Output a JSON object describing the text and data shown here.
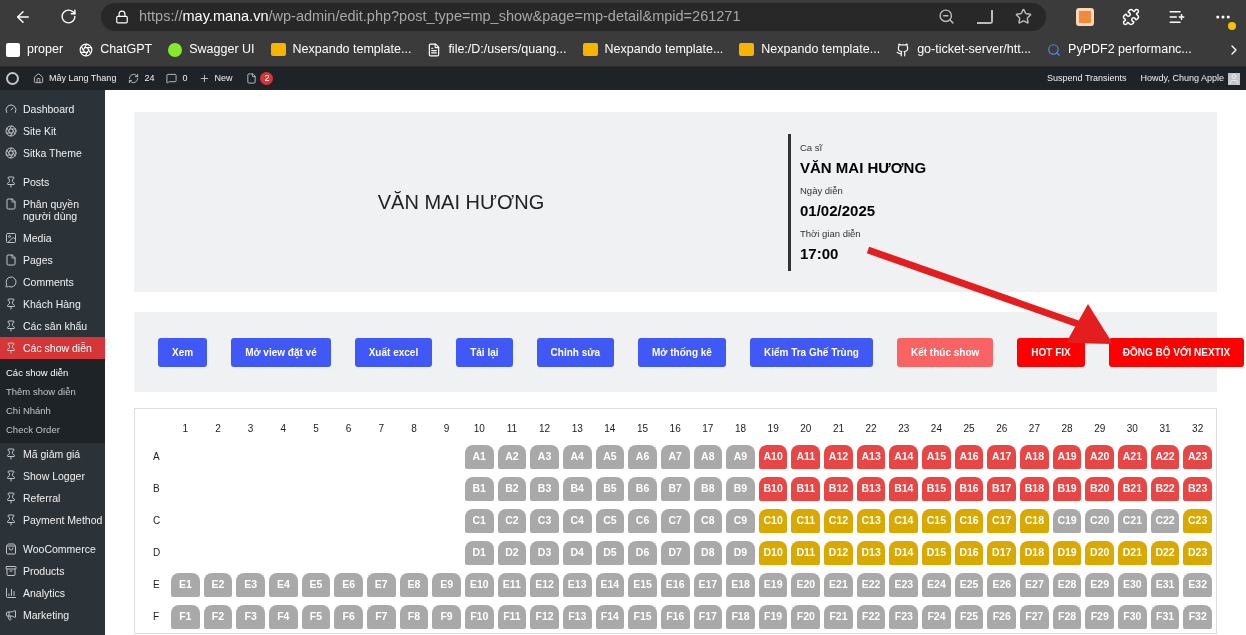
{
  "browser": {
    "url": "https://**may.mana.vn**/wp-admin/edit.php?post_type=mp_show&page=mp-detail&mpid=261271",
    "bookmarks": [
      "proper",
      "ChatGPT",
      "Swagger UI",
      "Nexpando template...",
      "file:/D:/users/quang...",
      "Nexpando template...",
      "Nexpando template...",
      "go-ticket-server/htt...",
      "PyPDF2 performanc..."
    ]
  },
  "admin_bar": {
    "site": "Mây Lang Thang",
    "updates": "24",
    "comments": "0",
    "new": "New",
    "badge": "2",
    "right": [
      "Suspend Transients",
      "Howdy, Chung Apple"
    ]
  },
  "sidebar": {
    "groups": [
      {
        "items": [
          {
            "label": "Dashboard",
            "selected": false
          },
          {
            "label": "Site Kit",
            "selected": false
          },
          {
            "label": "Sitka Theme",
            "selected": false
          }
        ]
      },
      {
        "items": [
          {
            "label": "Posts",
            "selected": false
          },
          {
            "label": "Phân quyền người dùng",
            "selected": false
          },
          {
            "label": "Media",
            "selected": false
          },
          {
            "label": "Pages",
            "selected": false
          },
          {
            "label": "Comments",
            "selected": false
          },
          {
            "label": "Khách Hàng",
            "selected": false
          },
          {
            "label": "Các sân khẩu",
            "selected": false
          },
          {
            "label": "Các show diễn",
            "selected": true,
            "children": [
              {
                "label": "Các show diễn",
                "selected": true
              },
              {
                "label": "Thêm show diễn",
                "selected": false
              },
              {
                "label": "Chi Nhánh",
                "selected": false
              },
              {
                "label": "Check Order",
                "selected": false
              }
            ]
          },
          {
            "label": "Mã giảm giá",
            "selected": false
          },
          {
            "label": "Show Logger",
            "selected": false
          },
          {
            "label": "Referral",
            "selected": false
          },
          {
            "label": "Payment Method",
            "selected": false
          }
        ]
      },
      {
        "items": [
          {
            "label": "WooCommerce",
            "selected": false
          },
          {
            "label": "Products",
            "selected": false
          },
          {
            "label": "Analytics",
            "selected": false
          },
          {
            "label": "Marketing",
            "selected": false
          }
        ]
      }
    ]
  },
  "show": {
    "title": "VĂN MAI HƯƠNG",
    "details": [
      {
        "label": "Ca sĩ",
        "value": "VĂN MAI HƯƠNG"
      },
      {
        "label": "Ngày diễn",
        "value": "01/02/2025"
      },
      {
        "label": "Thời gian diễn",
        "value": "17:00"
      }
    ]
  },
  "actions": [
    {
      "label": "Xem",
      "kind": "primary"
    },
    {
      "label": "Mở view đặt vé",
      "kind": "primary"
    },
    {
      "label": "Xuất excel",
      "kind": "primary"
    },
    {
      "label": "Tải lại",
      "kind": "primary"
    },
    {
      "label": "Chỉnh sửa",
      "kind": "primary"
    },
    {
      "label": "Mở thống kê",
      "kind": "primary"
    },
    {
      "label": "Kiểm Tra Ghế Trùng",
      "kind": "primary"
    },
    {
      "label": "Kết thúc show",
      "kind": "soft-danger"
    },
    {
      "label": "HOT FIX",
      "kind": "danger"
    },
    {
      "label": "ĐỒNG BỘ VỚI NEXTIX",
      "kind": "danger"
    }
  ],
  "seating": {
    "columns": [
      "1",
      "2",
      "3",
      "4",
      "5",
      "6",
      "7",
      "8",
      "9",
      "10",
      "11",
      "12",
      "13",
      "14",
      "15",
      "16",
      "17",
      "18",
      "19",
      "20",
      "21",
      "22",
      "23",
      "24",
      "25",
      "26",
      "27",
      "28",
      "29",
      "30",
      "31",
      "32"
    ],
    "rows": [
      {
        "label": "A",
        "seats": [
          {
            "label": "A1",
            "sold": false,
            "held": false
          },
          {
            "label": "A2",
            "sold": false,
            "held": false
          },
          {
            "label": "A3",
            "sold": false,
            "held": false
          },
          {
            "label": "A4",
            "sold": false,
            "held": false
          },
          {
            "label": "A5",
            "sold": false,
            "held": false
          },
          {
            "label": "A6",
            "sold": false,
            "held": false
          },
          {
            "label": "A7",
            "sold": false,
            "held": false
          },
          {
            "label": "A8",
            "sold": false,
            "held": false
          },
          {
            "label": "A9",
            "sold": false,
            "held": false
          },
          {
            "label": "A10",
            "sold": true,
            "held": false
          },
          {
            "label": "A11",
            "sold": true,
            "held": false
          },
          {
            "label": "A12",
            "sold": true,
            "held": false
          },
          {
            "label": "A13",
            "sold": true,
            "held": false
          },
          {
            "label": "A14",
            "sold": true,
            "held": false
          },
          {
            "label": "A15",
            "sold": true,
            "held": false
          },
          {
            "label": "A16",
            "sold": true,
            "held": false
          },
          {
            "label": "A17",
            "sold": true,
            "held": false
          },
          {
            "label": "A18",
            "sold": true,
            "held": false
          },
          {
            "label": "A19",
            "sold": true,
            "held": false
          },
          {
            "label": "A20",
            "sold": true,
            "held": false
          },
          {
            "label": "A21",
            "sold": true,
            "held": false
          },
          {
            "label": "A22",
            "sold": true,
            "held": false
          },
          {
            "label": "A23",
            "sold": true,
            "held": false
          }
        ]
      },
      {
        "label": "B",
        "seats": [
          {
            "label": "B1",
            "sold": false,
            "held": false
          },
          {
            "label": "B2",
            "sold": false,
            "held": false
          },
          {
            "label": "B3",
            "sold": false,
            "held": false
          },
          {
            "label": "B4",
            "sold": false,
            "held": false
          },
          {
            "label": "B5",
            "sold": false,
            "held": false
          },
          {
            "label": "B6",
            "sold": false,
            "held": false
          },
          {
            "label": "B7",
            "sold": false,
            "held": false
          },
          {
            "label": "B8",
            "sold": false,
            "held": false
          },
          {
            "label": "B9",
            "sold": false,
            "held": false
          },
          {
            "label": "B10",
            "sold": true,
            "held": false
          },
          {
            "label": "B11",
            "sold": true,
            "held": false
          },
          {
            "label": "B12",
            "sold": true,
            "held": false
          },
          {
            "label": "B13",
            "sold": true,
            "held": false
          },
          {
            "label": "B14",
            "sold": true,
            "held": false
          },
          {
            "label": "B15",
            "sold": true,
            "held": false
          },
          {
            "label": "B16",
            "sold": true,
            "held": false
          },
          {
            "label": "B17",
            "sold": true,
            "held": false
          },
          {
            "label": "B18",
            "sold": true,
            "held": false
          },
          {
            "label": "B19",
            "sold": true,
            "held": false
          },
          {
            "label": "B20",
            "sold": true,
            "held": false
          },
          {
            "label": "B21",
            "sold": true,
            "held": false
          },
          {
            "label": "B22",
            "sold": true,
            "held": false
          },
          {
            "label": "B23",
            "sold": true,
            "held": false
          }
        ]
      },
      {
        "label": "C",
        "seats": [
          {
            "label": "C1",
            "sold": false,
            "held": false
          },
          {
            "label": "C2",
            "sold": false,
            "held": false
          },
          {
            "label": "C3",
            "sold": false,
            "held": false
          },
          {
            "label": "C4",
            "sold": false,
            "held": false
          },
          {
            "label": "C5",
            "sold": false,
            "held": false
          },
          {
            "label": "C6",
            "sold": false,
            "held": false
          },
          {
            "label": "C7",
            "sold": false,
            "held": false
          },
          {
            "label": "C8",
            "sold": false,
            "held": false
          },
          {
            "label": "C9",
            "sold": false,
            "held": false
          },
          {
            "label": "C10",
            "sold": false,
            "held": true
          },
          {
            "label": "C11",
            "sold": false,
            "held": true
          },
          {
            "label": "C12",
            "sold": false,
            "held": true
          },
          {
            "label": "C13",
            "sold": false,
            "held": true
          },
          {
            "label": "C14",
            "sold": false,
            "held": true
          },
          {
            "label": "C15",
            "sold": false,
            "held": true
          },
          {
            "label": "C16",
            "sold": false,
            "held": true
          },
          {
            "label": "C17",
            "sold": false,
            "held": true
          },
          {
            "label": "C18",
            "sold": false,
            "held": true
          },
          {
            "label": "C19",
            "sold": false,
            "held": false
          },
          {
            "label": "C20",
            "sold": false,
            "held": false
          },
          {
            "label": "C21",
            "sold": false,
            "held": false
          },
          {
            "label": "C22",
            "sold": false,
            "held": false
          },
          {
            "label": "C23",
            "sold": false,
            "held": true
          }
        ]
      },
      {
        "label": "D",
        "seats": [
          {
            "label": "D1",
            "sold": false,
            "held": false
          },
          {
            "label": "D2",
            "sold": false,
            "held": false
          },
          {
            "label": "D3",
            "sold": false,
            "held": false
          },
          {
            "label": "D4",
            "sold": false,
            "held": false
          },
          {
            "label": "D5",
            "sold": false,
            "held": false
          },
          {
            "label": "D6",
            "sold": false,
            "held": false
          },
          {
            "label": "D7",
            "sold": false,
            "held": false
          },
          {
            "label": "D8",
            "sold": false,
            "held": false
          },
          {
            "label": "D9",
            "sold": false,
            "held": false
          },
          {
            "label": "D10",
            "sold": false,
            "held": true
          },
          {
            "label": "D11",
            "sold": false,
            "held": true
          },
          {
            "label": "D12",
            "sold": false,
            "held": true
          },
          {
            "label": "D13",
            "sold": false,
            "held": true
          },
          {
            "label": "D14",
            "sold": false,
            "held": true
          },
          {
            "label": "D15",
            "sold": false,
            "held": true
          },
          {
            "label": "D16",
            "sold": false,
            "held": true
          },
          {
            "label": "D17",
            "sold": false,
            "held": true
          },
          {
            "label": "D18",
            "sold": false,
            "held": true
          },
          {
            "label": "D19",
            "sold": false,
            "held": true
          },
          {
            "label": "D20",
            "sold": false,
            "held": true
          },
          {
            "label": "D21",
            "sold": false,
            "held": true
          },
          {
            "label": "D22",
            "sold": false,
            "held": true
          },
          {
            "label": "D23",
            "sold": false,
            "held": true
          }
        ]
      },
      {
        "label": "E",
        "seats": [
          {
            "label": "E1",
            "sold": false,
            "held": false
          },
          {
            "label": "E2",
            "sold": false,
            "held": false
          },
          {
            "label": "E3",
            "sold": false,
            "held": false
          },
          {
            "label": "E4",
            "sold": false,
            "held": false
          },
          {
            "label": "E5",
            "sold": false,
            "held": false
          },
          {
            "label": "E6",
            "sold": false,
            "held": false
          },
          {
            "label": "E7",
            "sold": false,
            "held": false
          },
          {
            "label": "E8",
            "sold": false,
            "held": false
          },
          {
            "label": "E9",
            "sold": false,
            "held": false
          },
          {
            "label": "E10",
            "sold": false,
            "held": false
          },
          {
            "label": "E11",
            "sold": false,
            "held": false
          },
          {
            "label": "E12",
            "sold": false,
            "held": false
          },
          {
            "label": "E13",
            "sold": false,
            "held": false
          },
          {
            "label": "E14",
            "sold": false,
            "held": false
          },
          {
            "label": "E15",
            "sold": false,
            "held": false
          },
          {
            "label": "E16",
            "sold": false,
            "held": false
          },
          {
            "label": "E17",
            "sold": false,
            "held": false
          },
          {
            "label": "E18",
            "sold": false,
            "held": false
          },
          {
            "label": "E19",
            "sold": false,
            "held": false
          },
          {
            "label": "E20",
            "sold": false,
            "held": false
          },
          {
            "label": "E21",
            "sold": false,
            "held": false
          },
          {
            "label": "E22",
            "sold": false,
            "held": false
          },
          {
            "label": "E23",
            "sold": false,
            "held": false
          },
          {
            "label": "E24",
            "sold": false,
            "held": false
          },
          {
            "label": "E25",
            "sold": false,
            "held": false
          },
          {
            "label": "E26",
            "sold": false,
            "held": false
          },
          {
            "label": "E27",
            "sold": false,
            "held": false
          },
          {
            "label": "E28",
            "sold": false,
            "held": false
          },
          {
            "label": "E29",
            "sold": false,
            "held": false
          },
          {
            "label": "E30",
            "sold": false,
            "held": false
          },
          {
            "label": "E31",
            "sold": false,
            "held": false
          },
          {
            "label": "E32",
            "sold": false,
            "held": false
          }
        ]
      },
      {
        "label": "F",
        "seats": [
          {
            "label": "F1",
            "sold": false,
            "held": false
          },
          {
            "label": "F2",
            "sold": false,
            "held": false
          },
          {
            "label": "F3",
            "sold": false,
            "held": false
          },
          {
            "label": "F4",
            "sold": false,
            "held": false
          },
          {
            "label": "F5",
            "sold": false,
            "held": false
          },
          {
            "label": "F6",
            "sold": false,
            "held": false
          },
          {
            "label": "F7",
            "sold": false,
            "held": false
          },
          {
            "label": "F8",
            "sold": false,
            "held": false
          },
          {
            "label": "F9",
            "sold": false,
            "held": false
          },
          {
            "label": "F10",
            "sold": false,
            "held": false
          },
          {
            "label": "F11",
            "sold": false,
            "held": false
          },
          {
            "label": "F12",
            "sold": false,
            "held": false
          },
          {
            "label": "F13",
            "sold": false,
            "held": false
          },
          {
            "label": "F14",
            "sold": false,
            "held": false
          },
          {
            "label": "F15",
            "sold": false,
            "held": false
          },
          {
            "label": "F16",
            "sold": false,
            "held": false
          },
          {
            "label": "F17",
            "sold": false,
            "held": false
          },
          {
            "label": "F18",
            "sold": false,
            "held": false
          },
          {
            "label": "F19",
            "sold": false,
            "held": false
          },
          {
            "label": "F20",
            "sold": false,
            "held": false
          },
          {
            "label": "F21",
            "sold": false,
            "held": false
          },
          {
            "label": "F22",
            "sold": false,
            "held": false
          },
          {
            "label": "F23",
            "sold": false,
            "held": false
          },
          {
            "label": "F24",
            "sold": false,
            "held": false
          },
          {
            "label": "F25",
            "sold": false,
            "held": false
          },
          {
            "label": "F26",
            "sold": false,
            "held": false
          },
          {
            "label": "F27",
            "sold": false,
            "held": false
          },
          {
            "label": "F28",
            "sold": false,
            "held": false
          },
          {
            "label": "F29",
            "sold": false,
            "held": false
          },
          {
            "label": "F30",
            "sold": false,
            "held": false
          },
          {
            "label": "F31",
            "sold": false,
            "held": false
          },
          {
            "label": "F32",
            "sold": false,
            "held": false
          }
        ]
      }
    ]
  }
}
